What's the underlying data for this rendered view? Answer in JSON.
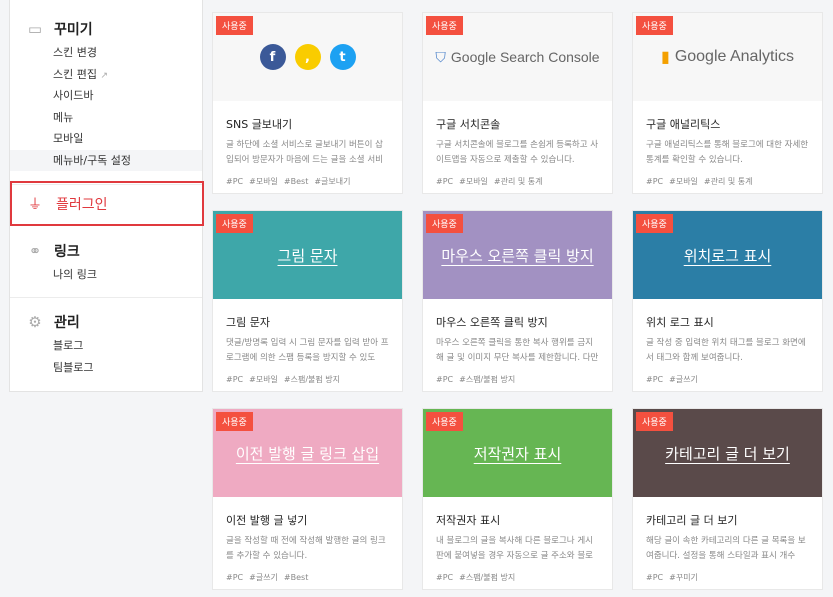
{
  "sidebar": {
    "decorate": {
      "label": "꾸미기",
      "items": [
        "스킨 변경",
        "스킨 편집",
        "사이드바",
        "메뉴",
        "모바일",
        "메뉴바/구독 설정"
      ]
    },
    "plugin": {
      "label": "플러그인"
    },
    "link": {
      "label": "링크",
      "items": [
        "나의 링크"
      ]
    },
    "manage": {
      "label": "관리",
      "items": [
        "블로그",
        "팀블로그"
      ]
    }
  },
  "badge_label": "사용중",
  "cards": [
    {
      "title": "SNS 글보내기",
      "desc": "글 하단에 소셜 서비스로 글보내기 버튼이 삽입되어 방문자가 마음에 드는 글을 소셜 서비스…",
      "tags": [
        "#PC",
        "#모바일",
        "#Best",
        "#글보내기"
      ],
      "image": "sns",
      "bg": "#f7f7f7"
    },
    {
      "title": "구글 서치콘솔",
      "desc": "구글 서치콘솔에 블로그를 손쉽게 등록하고 사이트맵을 자동으로 제출할 수 있습니다.",
      "tags": [
        "#PC",
        "#모바일",
        "#관리 및 통계"
      ],
      "image": "Google Search Console",
      "bg": "#f7f7f7"
    },
    {
      "title": "구글 애널리틱스",
      "desc": "구글 애널리틱스를 통해 블로그에 대한 자세한 통계를 확인할 수 있습니다.",
      "tags": [
        "#PC",
        "#모바일",
        "#관리 및 통계"
      ],
      "image": "Google Analytics",
      "bg": "#f7f7f7"
    },
    {
      "title": "그림 문자",
      "desc": "댓글/방명록 입력 시 그림 문자를 입력 받아 프로그램에 의한 스팸 등록을 방지할 수 있도록…",
      "tags": [
        "#PC",
        "#모바일",
        "#스팸/불펌 방지"
      ],
      "image": "그림 문자",
      "bg": "#3ea7a9"
    },
    {
      "title": "마우스 오른쪽 클릭 방지",
      "desc": "마우스 오른쪽 클릭을 통한 복사 행위를 금지해 글 및 이미지 무단 복사를 제한합니다. 다만 …",
      "tags": [
        "#PC",
        "#스팸/불펌 방지"
      ],
      "image": "마우스 오른쪽 클릭 방지",
      "bg": "#a291c2"
    },
    {
      "title": "위치 로그 표시",
      "desc": "글 작성 중 입력한 위치 태그를 블로그 화면에서 태그와 함께 보여줍니다.",
      "tags": [
        "#PC",
        "#글쓰기"
      ],
      "image": "위치로그 표시",
      "bg": "#2b7ea6"
    },
    {
      "title": "이전 발행 글 넣기",
      "desc": "글을 작성할 때 전에 작성해 발행한 글의 링크를 추가할 수 있습니다.",
      "tags": [
        "#PC",
        "#글쓰기",
        "#Best"
      ],
      "image": "이전 발행 글 링크 삽입",
      "bg": "#efaac2"
    },
    {
      "title": "저작권자 표시",
      "desc": "내 블로그의 글을 복사해 다른 블로그나 게시판에 붙여넣을 경우 자동으로 글 주소와 블로그…",
      "tags": [
        "#PC",
        "#스팸/불펌 방지"
      ],
      "image": "저작권자 표시",
      "bg": "#66b653"
    },
    {
      "title": "카테고리 글 더 보기",
      "desc": "해당 글이 속한 카테고리의 다른 글 목록을 보여줍니다. 설정을 통해 스타일과 표시 개수를…",
      "tags": [
        "#PC",
        "#꾸미기"
      ],
      "image": "카테고리 글 더 보기",
      "bg": "#5a4a4a"
    }
  ]
}
